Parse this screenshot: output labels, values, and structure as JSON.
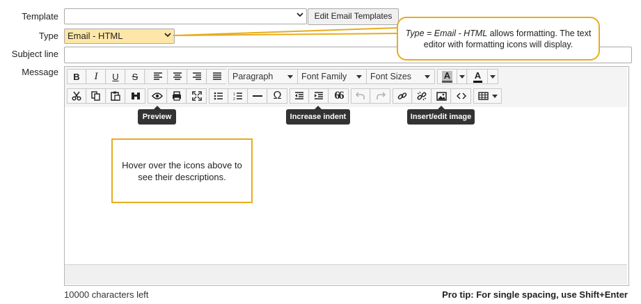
{
  "form": {
    "template_label": "Template",
    "template_value": "",
    "edit_templates_button": "Edit Email Templates",
    "type_label": "Type",
    "type_value": "Email - HTML",
    "subject_label": "Subject line",
    "subject_value": "",
    "message_label": "Message"
  },
  "callout": {
    "prefix": "Type = Email - HTML",
    "suffix": " allows formatting. The text editor with formatting icons will display."
  },
  "toolbar": {
    "paragraph_label": "Paragraph",
    "font_family_label": "Font Family",
    "font_sizes_label": "Font Sizes",
    "bold_label": "B",
    "italic_label": "I",
    "underline_label": "U",
    "strike_label": "S",
    "omega_label": "Ω",
    "quote_label": "66",
    "bg_color_label": "A",
    "text_color_label": "A",
    "highlight_color": "#555555",
    "text_color": "#000000"
  },
  "tooltips": {
    "preview": "Preview",
    "increase_indent": "Increase indent",
    "insert_image": "Insert/edit image"
  },
  "editor": {
    "hover_hint": "Hover over the icons above to see their descriptions."
  },
  "footer": {
    "chars_left": "10000 characters left",
    "pro_tip": "Pro tip: For single spacing, use Shift+Enter"
  },
  "colors": {
    "accent_border": "#e6ac1f",
    "type_select_bg": "#fde6a7"
  }
}
